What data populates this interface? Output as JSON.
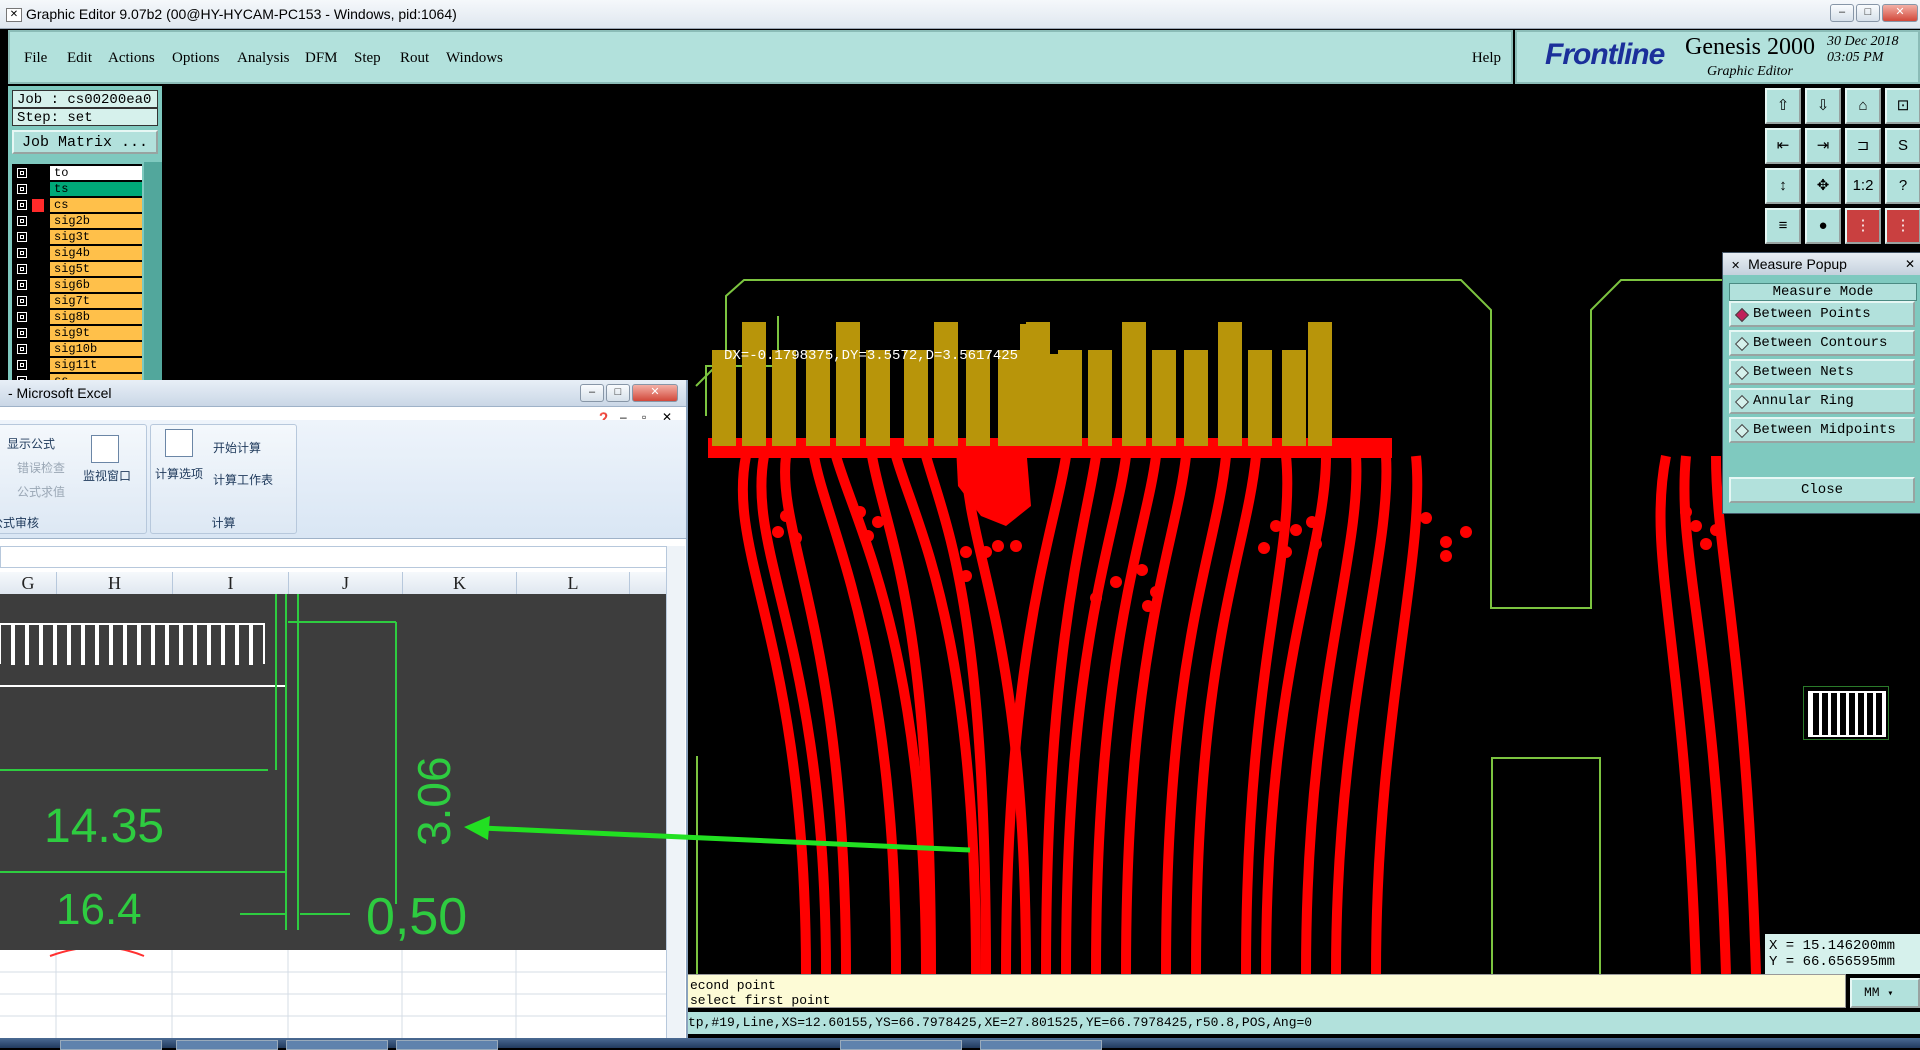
{
  "window": {
    "title": "Graphic Editor 9.07b2 (00@HY-HYCAM-PC153 - Windows, pid:1064)",
    "min": "–",
    "max": "□",
    "close": "✕"
  },
  "menu": [
    "File",
    "Edit",
    "Actions",
    "Options",
    "Analysis",
    "DFM",
    "Step",
    "Rout",
    "Windows"
  ],
  "help": "Help",
  "brand": {
    "logo": "Frontline",
    "product": "Genesis 2000",
    "sub": "Graphic Editor",
    "date": "30 Dec 2018",
    "time": "03:05 PM"
  },
  "job": {
    "job": "Job : cs00200ea0",
    "step": "Step: set",
    "matrix": "Job Matrix ..."
  },
  "layers": [
    {
      "name": "to",
      "color": "#ffffff"
    },
    {
      "name": "ts",
      "color": "#00a878"
    },
    {
      "name": "cs",
      "color": "#ffc04a",
      "marker": "#ff2a2a"
    },
    {
      "name": "sig2b",
      "color": "#ffc04a"
    },
    {
      "name": "sig3t",
      "color": "#ffc04a"
    },
    {
      "name": "sig4b",
      "color": "#ffc04a"
    },
    {
      "name": "sig5t",
      "color": "#ffc04a"
    },
    {
      "name": "sig6b",
      "color": "#ffc04a"
    },
    {
      "name": "sig7t",
      "color": "#ffc04a"
    },
    {
      "name": "sig8b",
      "color": "#ffc04a"
    },
    {
      "name": "sig9t",
      "color": "#ffc04a"
    },
    {
      "name": "sig10b",
      "color": "#ffc04a"
    },
    {
      "name": "sig11t",
      "color": "#ffc04a"
    },
    {
      "name": "ss",
      "color": "#ffc04a"
    }
  ],
  "measure": {
    "title": "Measure Popup",
    "mode_label": "Measure Mode",
    "options": [
      "Between Points",
      "Between Contours",
      "Between Nets",
      "Annular Ring",
      "Between Midpoints"
    ],
    "selected": "Between Points",
    "close": "Close"
  },
  "readout": "DX=-0.1798375,DY=3.5572,D=3.5617425",
  "coords": {
    "x": "X = 15.146200mm",
    "y": "Y = 66.656595mm"
  },
  "unit": "MM",
  "prompt": {
    "line1": "econd point",
    "line2": "select first point"
  },
  "status": "tp,#19,Line,XS=12.60155,YS=66.7978425,XE=27.801525,YE=66.7978425,r50.8,POS,Ang=0",
  "excel": {
    "title": "- Microsoft Excel",
    "ribbon": {
      "audit": [
        "显示公式",
        "错误检查",
        "公式求值"
      ],
      "watch": "监视窗口",
      "audit_group": "公式审核",
      "calc_opts": "计算选项",
      "calc_now": "开始计算",
      "calc_sheet": "计算工作表",
      "calc_group": "计算"
    },
    "columns": [
      "G",
      "H",
      "I",
      "J",
      "K",
      "L"
    ],
    "dims": {
      "a": "14.35",
      "b": "16.4",
      "c": "3.06",
      "d": "0,50"
    }
  }
}
